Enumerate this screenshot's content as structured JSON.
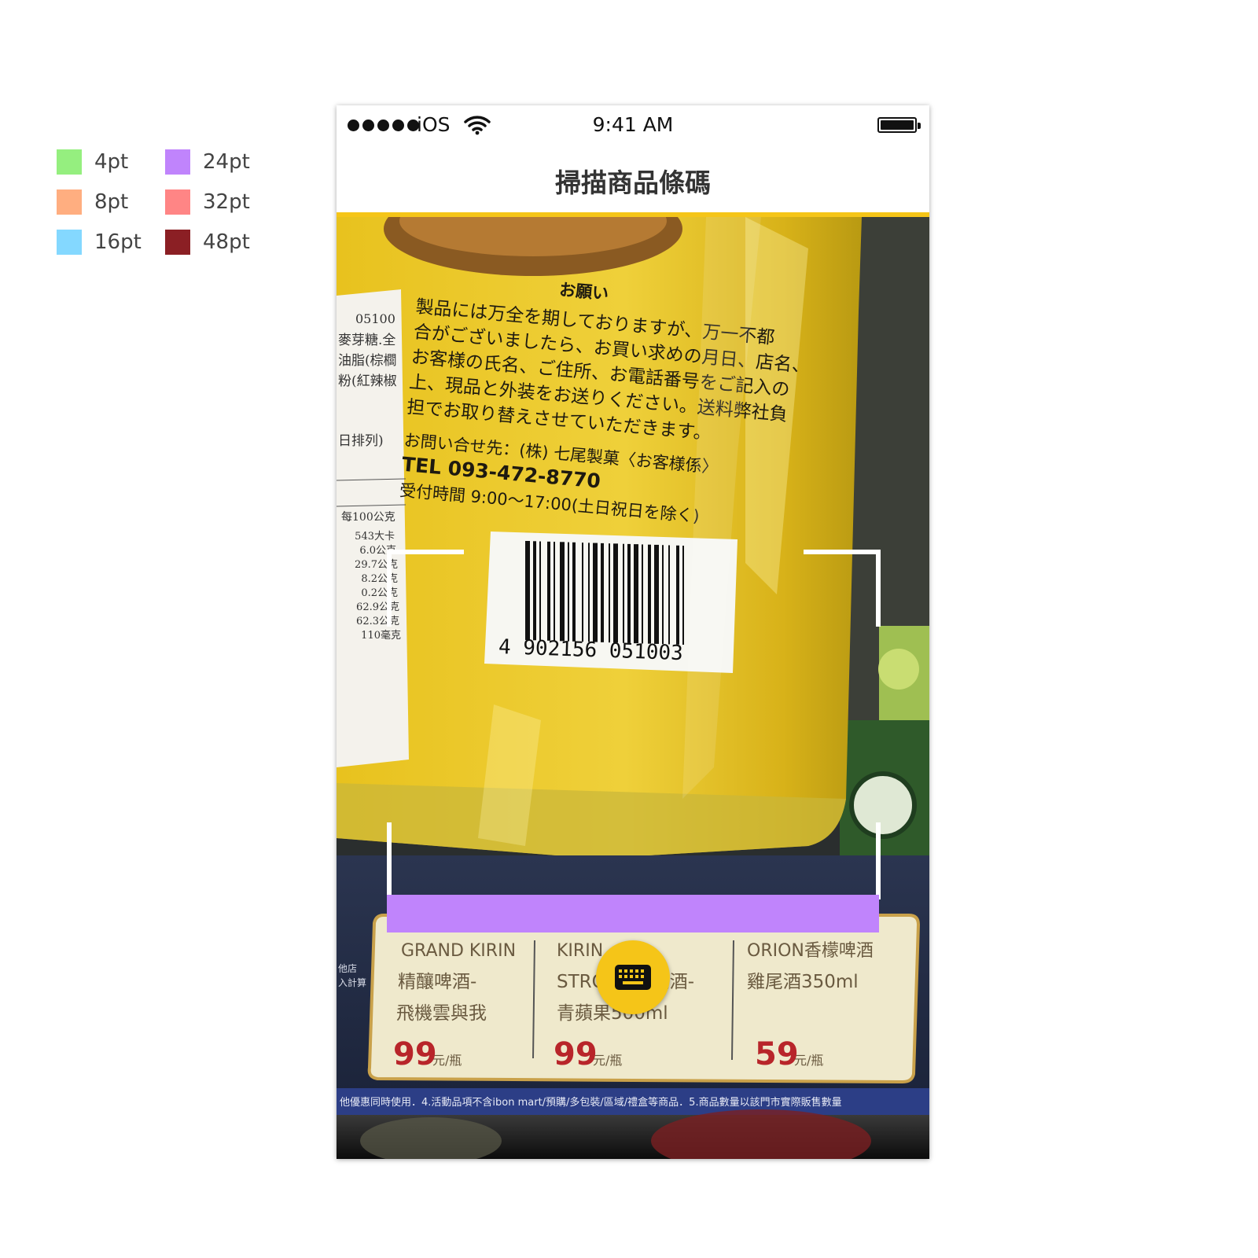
{
  "legend": [
    {
      "label": "4pt",
      "color": "#95ef7f"
    },
    {
      "label": "8pt",
      "color": "#ffae80"
    },
    {
      "label": "16pt",
      "color": "#84d8ff"
    },
    {
      "label": "24pt",
      "color": "#c084fc"
    },
    {
      "label": "32pt",
      "color": "#ff8585"
    },
    {
      "label": "48pt",
      "color": "#8b1f24"
    }
  ],
  "status_bar": {
    "carrier": "iOS",
    "time": "9:41 AM",
    "signal_icon": "signal-dots-icon",
    "wifi_icon": "wifi-icon",
    "battery_icon": "battery-icon"
  },
  "nav": {
    "title": "掃描商品條碼"
  },
  "camera": {
    "package": {
      "heading": "お願い",
      "lines": [
        "製品には万全を期しておりますが、万一不都",
        "合がございましたら、お買い求めの月日、店名、",
        "お客様の氏名、ご住所、お電話番号をご記入の",
        "上、現品と外装をお送りください。送料弊社負",
        "担でお取り替えさせていただきます。"
      ],
      "contact_line": "お問い合せ先：(株) 七尾製菓〈お客様係〉",
      "tel_line": "TEL 093-472-8770",
      "hours_line": "受付時間 9:00〜17:00(土日祝日を除く)",
      "barcode_digits": "4 902156 051003"
    },
    "nutrition_label": {
      "code": "05100",
      "ingredients": [
        "麥芽糖.全",
        "油脂(棕櫚",
        "粉(紅辣椒"
      ],
      "note": "日排列)",
      "per": "每100公克",
      "values": [
        "543大卡",
        "6.0公克",
        "29.7公克",
        "8.2公克",
        "0.2公克",
        "62.9公克",
        "62.3公克",
        "110毫克"
      ]
    },
    "price_tags": [
      {
        "name_line1": "GRAND KIRIN",
        "name_line2": "精釀啤酒-",
        "name_line3": "飛機雲與我",
        "price": "99",
        "unit": "元/瓶"
      },
      {
        "name_line1": "KIRIN",
        "name_line2": "STRONG果調酒-",
        "name_line3": "青蘋果500ml",
        "price": "99",
        "unit": "元/瓶"
      },
      {
        "name_line1": "ORION香檬啤酒",
        "name_line2": "雞尾酒350ml",
        "name_line3": "",
        "price": "59",
        "unit": "元/瓶"
      }
    ],
    "shelf_strip": "他優惠同時使用．4.活動品項不含ibon mart/預購/多包裝/區域/禮盒等商品．5.商品數量以該門市實際販售數量",
    "shelf_side": [
      "他店",
      "入計算"
    ],
    "keyboard_icon": "keyboard-icon"
  },
  "spacing_overlay": {
    "label": "24pt",
    "color": "#c084fc"
  }
}
